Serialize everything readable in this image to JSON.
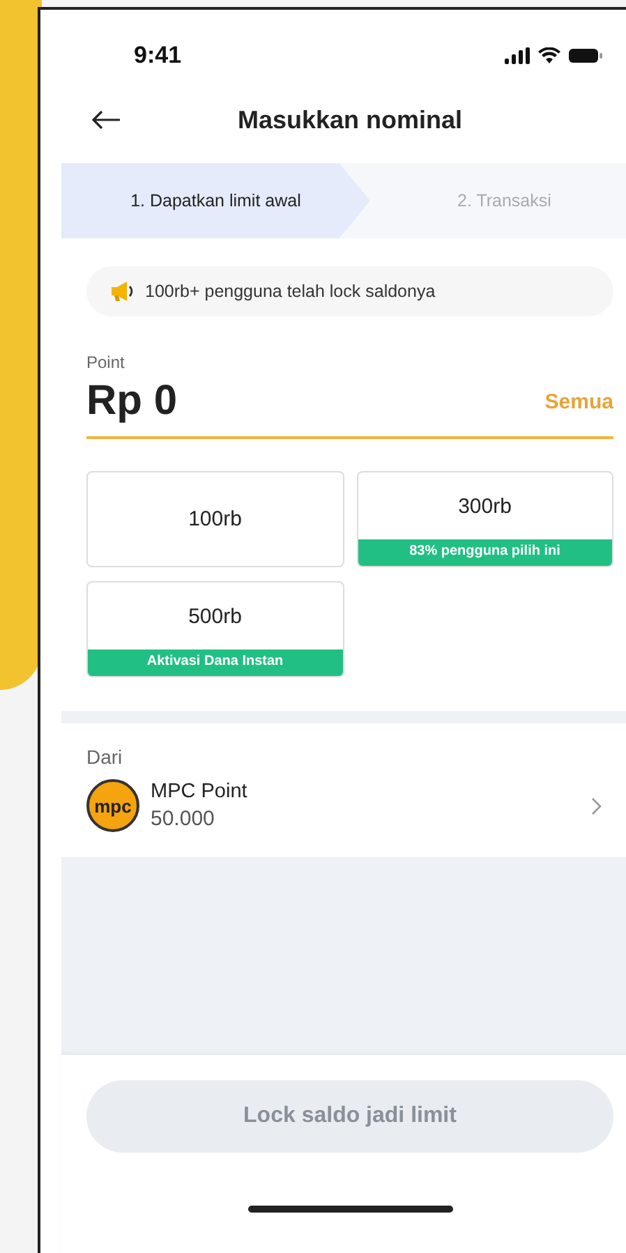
{
  "status_bar": {
    "time": "9:41"
  },
  "header": {
    "title": "Masukkan nominal"
  },
  "steps": [
    {
      "label": "1. Dapatkan limit awal",
      "selected": true
    },
    {
      "label": "2. Transaksi",
      "selected": false
    }
  ],
  "banner": {
    "text": "100rb+ pengguna telah lock saldonya"
  },
  "amount": {
    "label": "Point",
    "value": "Rp 0",
    "action": "Semua"
  },
  "options": [
    {
      "label": "100rb"
    },
    {
      "label": "300rb",
      "tag": "83% pengguna pilih ini"
    },
    {
      "label": "500rb",
      "tag": "Aktivasi Dana Instan"
    }
  ],
  "source": {
    "label": "Dari",
    "logo": "mpc",
    "name": "MPC Point",
    "balance": "50.000"
  },
  "button": {
    "label": "Lock saldo jadi limit",
    "disabled": true
  }
}
